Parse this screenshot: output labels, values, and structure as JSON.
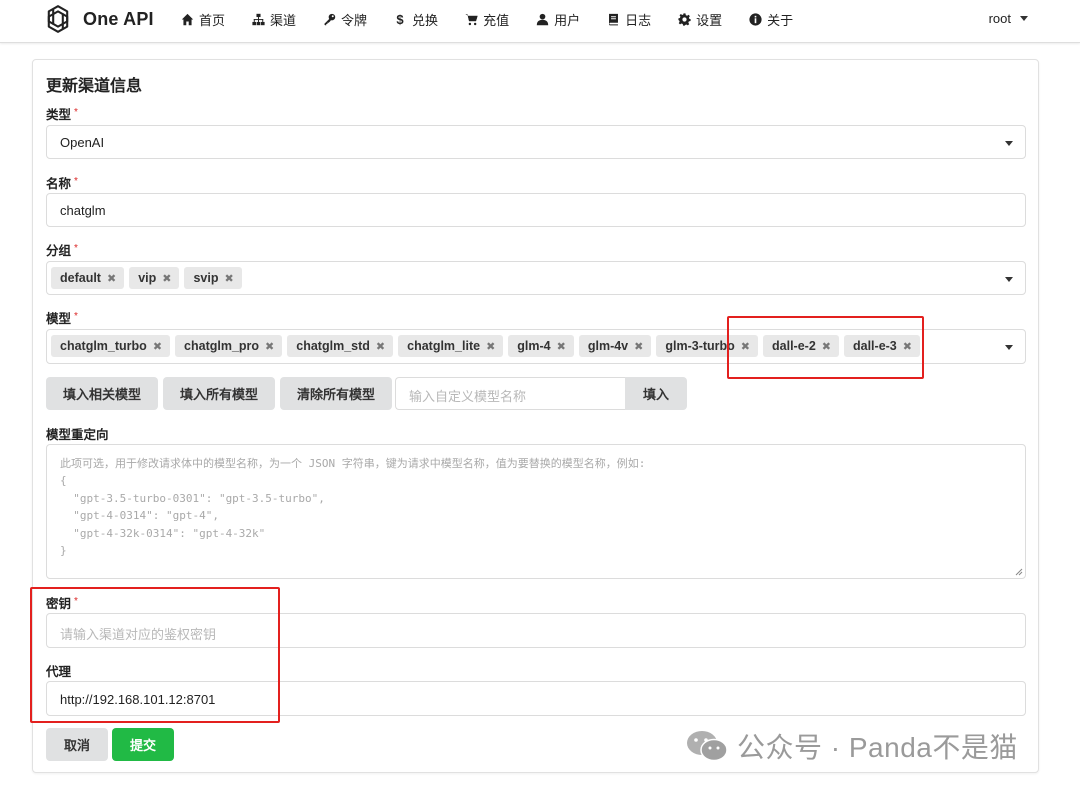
{
  "header": {
    "brand": "One API",
    "nav": [
      {
        "label": "首页",
        "icon": "home-icon"
      },
      {
        "label": "渠道",
        "icon": "sitemap-icon"
      },
      {
        "label": "令牌",
        "icon": "key-icon"
      },
      {
        "label": "兑换",
        "icon": "dollar-icon"
      },
      {
        "label": "充值",
        "icon": "cart-icon"
      },
      {
        "label": "用户",
        "icon": "user-icon"
      },
      {
        "label": "日志",
        "icon": "book-icon"
      },
      {
        "label": "设置",
        "icon": "gear-icon"
      },
      {
        "label": "关于",
        "icon": "info-icon"
      }
    ],
    "user": "root"
  },
  "form": {
    "title": "更新渠道信息",
    "type": {
      "label": "类型",
      "value": "OpenAI"
    },
    "name": {
      "label": "名称",
      "value": "chatglm"
    },
    "group": {
      "label": "分组",
      "chips": [
        "default",
        "vip",
        "svip"
      ]
    },
    "models": {
      "label": "模型",
      "chips": [
        "chatglm_turbo",
        "chatglm_pro",
        "chatglm_std",
        "chatglm_lite",
        "glm-4",
        "glm-4v",
        "glm-3-turbo",
        "dall-e-2",
        "dall-e-3"
      ]
    },
    "model_buttons": {
      "fill_related": "填入相关模型",
      "fill_all": "填入所有模型",
      "clear_all": "清除所有模型",
      "custom_placeholder": "输入自定义模型名称",
      "fill": "填入"
    },
    "mapping": {
      "label": "模型重定向",
      "placeholder": "此项可选，用于修改请求体中的模型名称，为一个 JSON 字符串，键为请求中模型名称，值为要替换的模型名称，例如:\n{\n  \"gpt-3.5-turbo-0301\": \"gpt-3.5-turbo\",\n  \"gpt-4-0314\": \"gpt-4\",\n  \"gpt-4-32k-0314\": \"gpt-4-32k\"\n}"
    },
    "key": {
      "label": "密钥",
      "placeholder": "请输入渠道对应的鉴权密钥"
    },
    "proxy": {
      "label": "代理",
      "value": "http://192.168.101.12:8701"
    },
    "cancel": "取消",
    "submit": "提交",
    "required_mark": "*"
  },
  "watermark": "公众号 · Panda不是猫",
  "colors": {
    "accent_green": "#21ba45",
    "highlight_red": "#e3201e",
    "required_red": "#db2828"
  }
}
